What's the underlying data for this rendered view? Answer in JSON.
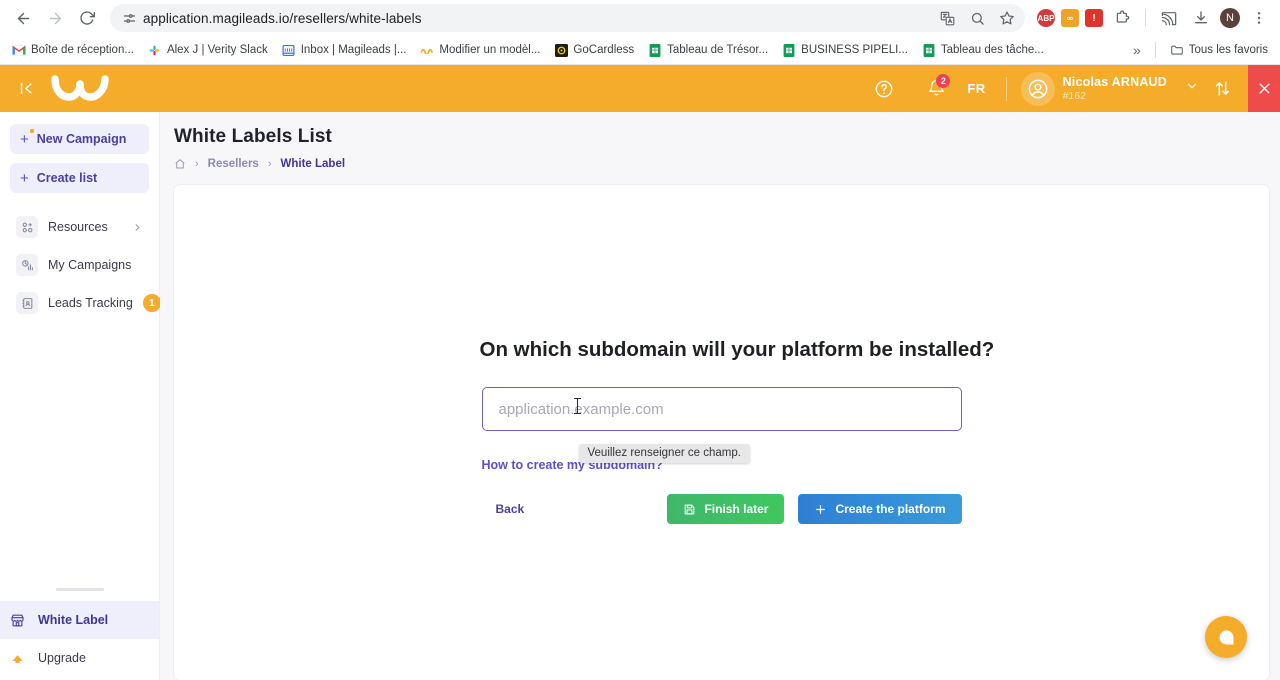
{
  "browser": {
    "url": "application.magileads.io/resellers/white-labels",
    "nav": {
      "back": "back-arrow",
      "forward": "forward-arrow",
      "reload": "reload"
    },
    "omnibox_actions": [
      "translate-icon",
      "search-icon",
      "bookmark-star-icon"
    ],
    "extensions": [
      {
        "name": "adblock-plus",
        "label": "ABP",
        "color": "#d23b3b"
      },
      {
        "name": "extension-orange",
        "label": "∞",
        "color": "#f0a32a"
      },
      {
        "name": "extension-alert",
        "label": "!",
        "color": "#e0342b"
      },
      {
        "name": "extensions-puzzle",
        "label": "",
        "color": "#5f6368"
      }
    ],
    "toolbar_icons": [
      "cast-icon",
      "download-icon"
    ],
    "profile_initial": "N",
    "menu": "three-dot-menu-icon",
    "bookmarks": [
      {
        "label": "Boîte de réception...",
        "icon": "gmail-icon"
      },
      {
        "label": "Alex J | Verity Slack",
        "icon": "slack-icon"
      },
      {
        "label": "Inbox | Magileads |...",
        "icon": "inbox-icon"
      },
      {
        "label": "Modifier un modèl...",
        "icon": "magileads-icon"
      },
      {
        "label": "GoCardless",
        "icon": "gocardless-icon"
      },
      {
        "label": "Tableau de Trésor...",
        "icon": "sheets-icon"
      },
      {
        "label": "BUSINESS PIPELI...",
        "icon": "sheets-icon"
      },
      {
        "label": "Tableau des tâche...",
        "icon": "sheets-icon"
      }
    ],
    "overflow_label": "»",
    "all_bookmarks_label": "Tous les favoris"
  },
  "app_header": {
    "collapse_icon": "collapse-sidebar-icon",
    "logo": "magileads-logo",
    "help_icon": "help-circle-icon",
    "notifications_icon": "bell-icon",
    "notifications_count": "2",
    "language": "FR",
    "avatar_icon": "user-avatar-icon",
    "user_name": "Nicolas ARNAUD",
    "user_id": "#162",
    "chevron_icon": "chevron-down-icon",
    "switch_icon": "sort-arrows-icon",
    "close_icon": "close-icon",
    "accent_color": "#f5ac2a",
    "close_color": "#ef4b4b"
  },
  "sidebar": {
    "actions": [
      {
        "label": "New Campaign",
        "icon": "plus-sparkle-icon"
      },
      {
        "label": "Create list",
        "icon": "plus-icon"
      }
    ],
    "items": [
      {
        "label": "Resources",
        "icon": "resources-icon",
        "chevron": "chevron-right-icon"
      },
      {
        "label": "My Campaigns",
        "icon": "campaigns-chart-icon"
      },
      {
        "label": "Leads Tracking",
        "icon": "leads-tracking-icon",
        "badge": "1"
      }
    ],
    "bottom_items": [
      {
        "label": "White Label",
        "icon": "storefront-icon",
        "active": true
      },
      {
        "label": "Upgrade",
        "icon": "upgrade-arrow-icon",
        "active": false
      }
    ]
  },
  "page": {
    "title": "White Labels List",
    "breadcrumb": {
      "home_icon": "home-icon",
      "separator": "›",
      "parent": "Resellers",
      "current": "White Label"
    }
  },
  "form": {
    "heading": "On which subdomain will your platform be installed?",
    "input_value": "",
    "input_placeholder": "application.example.com",
    "validation_message": "Veuillez renseigner ce champ.",
    "help_link": "How to create my subdomain?",
    "back_label": "Back",
    "finish_later_label": "Finish later",
    "finish_later_icon": "save-floppy-icon",
    "create_label": "Create the platform",
    "create_icon": "plus-icon",
    "green_color": "#3fb76b",
    "blue_color": "#2f7fd4",
    "focus_border_color": "#6e62c7"
  },
  "fab": {
    "icon": "chat-bubble-icon",
    "color": "#f5ac2a"
  }
}
